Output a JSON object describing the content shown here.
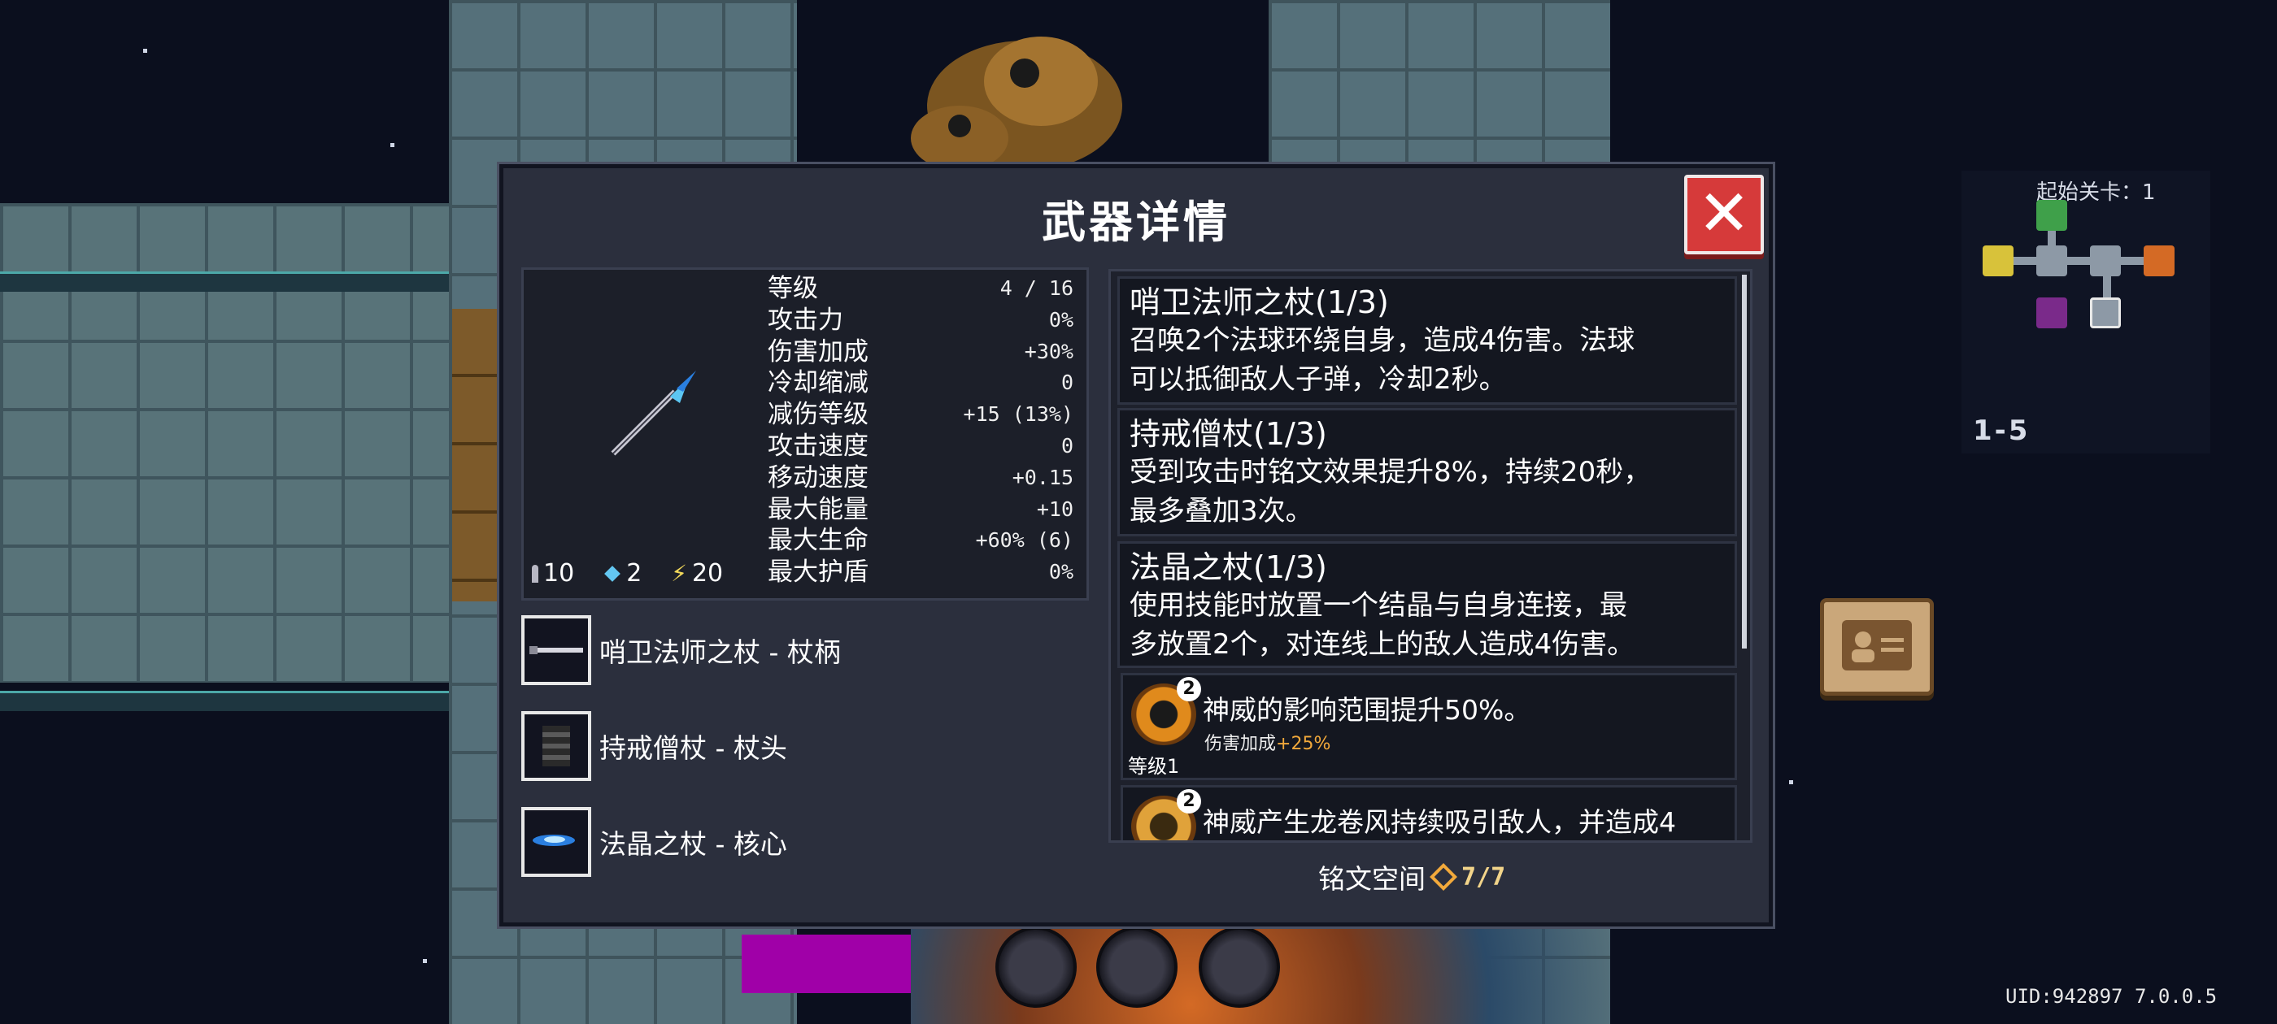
{
  "dialog": {
    "title": "武器详情",
    "close_label": "✕"
  },
  "weapon": {
    "icon": "ice-staff-icon",
    "resources": [
      {
        "icon": "bullet-icon",
        "value": "10",
        "color": "#b8b8c4"
      },
      {
        "icon": "diamond-icon",
        "value": "2",
        "color": "#63c7f2"
      },
      {
        "icon": "lightning-icon",
        "value": "20",
        "color": "#f2d85a"
      }
    ],
    "stats": [
      {
        "label": "等级",
        "value": "4 / 16"
      },
      {
        "label": "攻击力",
        "value": "0%"
      },
      {
        "label": "伤害加成",
        "value": "+30%"
      },
      {
        "label": "冷却缩减",
        "value": "0"
      },
      {
        "label": "减伤等级",
        "value": "+15 (13%)"
      },
      {
        "label": "攻击速度",
        "value": "0"
      },
      {
        "label": "移动速度",
        "value": "+0.15"
      },
      {
        "label": "最大能量",
        "value": "+10"
      },
      {
        "label": "最大生命",
        "value": "+60% (6)"
      },
      {
        "label": "最大护盾",
        "value": "0%"
      }
    ]
  },
  "parts": [
    {
      "icon": "staff-handle-icon",
      "label": "哨卫法师之杖 - 杖柄"
    },
    {
      "icon": "staff-head-icon",
      "label": "持戒僧杖 - 杖头"
    },
    {
      "icon": "crystal-core-icon",
      "label": "法晶之杖 - 核心"
    }
  ],
  "effects": [
    {
      "title": "哨卫法师之杖(1/3)",
      "lines": [
        "召唤2个法球环绕自身，造成4伤害。法球",
        "可以抵御敌人子弹，冷却2秒。"
      ]
    },
    {
      "title": "持戒僧杖(1/3)",
      "lines": [
        "受到攻击时铭文效果提升8%，持续20秒，",
        "最多叠加3次。"
      ]
    },
    {
      "title": "法晶之杖(1/3)",
      "lines": [
        "使用技能时放置一个结晶与自身连接，最",
        "多放置2个，对连线上的敌人造成4伤害。"
      ]
    }
  ],
  "runes": [
    {
      "icon": "vortex-rune-icon",
      "badge": "2",
      "text": "神威的影响范围提升50%。",
      "sub_label": "伤害加成",
      "sub_bonus": "+25%",
      "level": "等级1"
    },
    {
      "icon": "tornado-rune-icon",
      "badge": "2",
      "text": "神威产生龙卷风持续吸引敌人，并造成4"
    }
  ],
  "inscription": {
    "label": "铭文空间",
    "count": "7/7"
  },
  "minimap": {
    "title": "起始关卡：1",
    "floor": "1-5"
  },
  "footer": {
    "uid": "UID:942897 7.0.0.5"
  }
}
